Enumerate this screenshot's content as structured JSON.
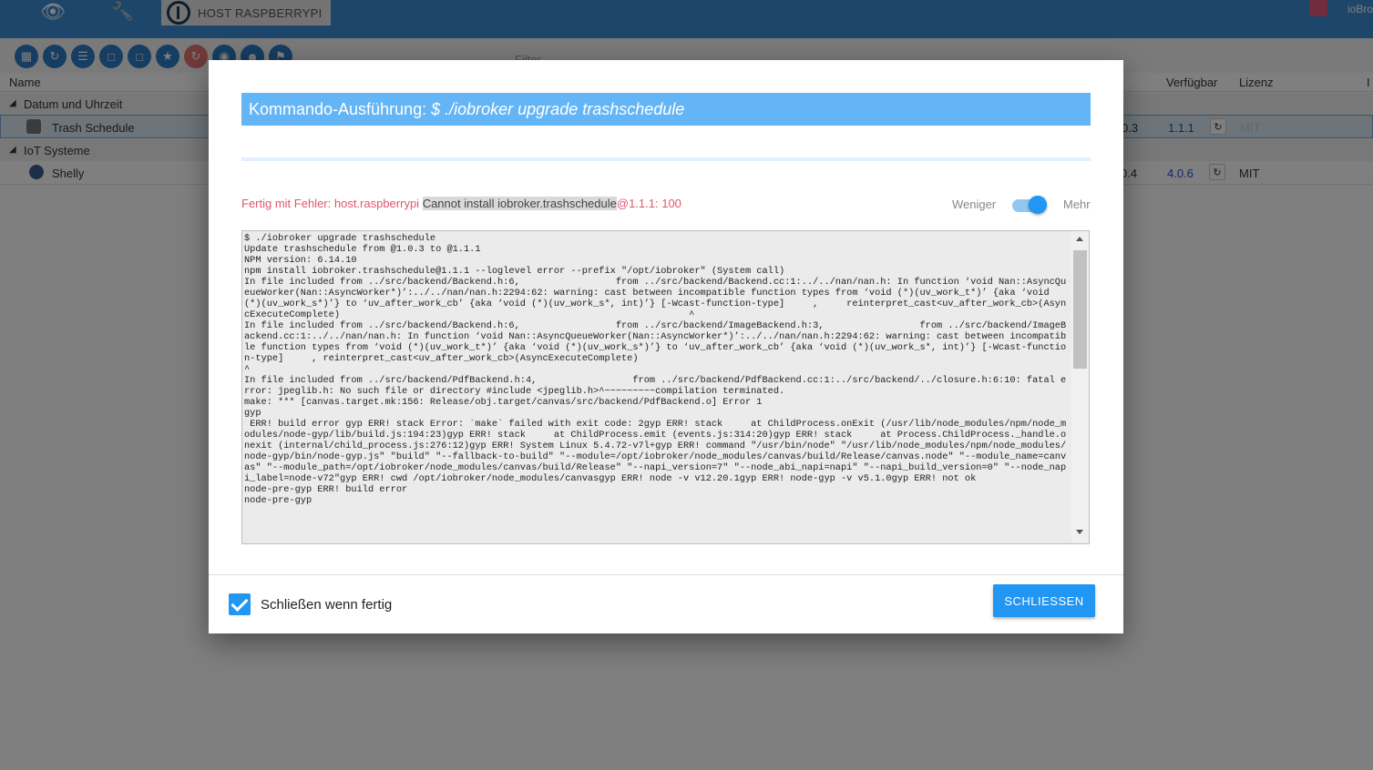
{
  "topbar": {
    "host_tab_label": "HOST RASPBERRYPI",
    "user_label": "ioBro"
  },
  "toolbar": {
    "filter_label": "Filter"
  },
  "table": {
    "headers": {
      "name": "Name",
      "available": "Verfügbar",
      "license": "Lizenz",
      "extra": "I"
    },
    "groups": [
      {
        "label": "Datum und Uhrzeit",
        "items": [
          {
            "name": "Trash Schedule",
            "installed": "0.3",
            "available": "1.1.1",
            "license": "MIT"
          }
        ]
      },
      {
        "label": "IoT Systeme",
        "items": [
          {
            "name": "Shelly",
            "installed": "0.4",
            "available": "4.0.6",
            "license": "MIT"
          }
        ]
      }
    ]
  },
  "dialog": {
    "title_prefix": "Kommando-Ausführung: ",
    "title_command": "$ ./iobroker upgrade trashschedule",
    "status_prefix": "Fertig mit Fehler: host.raspberrypi ",
    "status_highlight": "Cannot install iobroker.trashschedule",
    "status_suffix": "@1.1.1: 100",
    "toggle_less": "Weniger",
    "toggle_more": "Mehr",
    "toggle_state": "on",
    "log_lines": [
      "$ ./iobroker upgrade trashschedule",
      "Update trashschedule from @1.0.3 to @1.1.1",
      "NPM version: 6.14.10",
      "npm install iobroker.trashschedule@1.1.1 --loglevel error --prefix \"/opt/iobroker\" (System call)",
      "In file included from ../src/backend/Backend.h:6,                 from ../src/backend/Backend.cc:1:../../nan/nan.h: In function ‘void Nan::AsyncQueueWorker(Nan::AsyncWorker*)’:../../nan/nan.h:2294:62: warning: cast between incompatible function types from ‘void (*)(uv_work_t*)’ {aka ‘void (*)(uv_work_s*)’} to ‘uv_after_work_cb’ {aka ‘void (*)(uv_work_s*, int)’} [-Wcast-function-type]     ,     reinterpret_cast<uv_after_work_cb>(AsyncExecuteComplete)                                                              ^",
      "In file included from ../src/backend/Backend.h:6,                 from ../src/backend/ImageBackend.h:3,                 from ../src/backend/ImageBackend.cc:1:../../nan/nan.h: In function ‘void Nan::AsyncQueueWorker(Nan::AsyncWorker*)’:../../nan/nan.h:2294:62: warning: cast between incompatible function types from ‘void (*)(uv_work_t*)’ {aka ‘void (*)(uv_work_s*)’} to ‘uv_after_work_cb’ {aka ‘void (*)(uv_work_s*, int)’} [-Wcast-function-type]     , reinterpret_cast<uv_after_work_cb>(AsyncExecuteComplete)",
      "^",
      "In file included from ../src/backend/PdfBackend.h:4,                 from ../src/backend/PdfBackend.cc:1:../src/backend/../closure.h:6:10: fatal error: jpeglib.h: No such file or directory #include <jpeglib.h>^~~~~~~~~~compilation terminated.",
      "make: *** [canvas.target.mk:156: Release/obj.target/canvas/src/backend/PdfBackend.o] Error 1",
      "gyp",
      " ERR! build error gyp ERR! stack Error: `make` failed with exit code: 2gyp ERR! stack     at ChildProcess.onExit (/usr/lib/node_modules/npm/node_modules/node-gyp/lib/build.js:194:23)gyp ERR! stack     at ChildProcess.emit (events.js:314:20)gyp ERR! stack     at Process.ChildProcess._handle.onexit (internal/child_process.js:276:12)gyp ERR! System Linux 5.4.72-v7l+gyp ERR! command \"/usr/bin/node\" \"/usr/lib/node_modules/npm/node_modules/node-gyp/bin/node-gyp.js\" \"build\" \"--fallback-to-build\" \"--module=/opt/iobroker/node_modules/canvas/build/Release/canvas.node\" \"--module_name=canvas\" \"--module_path=/opt/iobroker/node_modules/canvas/build/Release\" \"--napi_version=7\" \"--node_abi_napi=napi\" \"--napi_build_version=0\" \"--node_napi_label=node-v72\"gyp ERR! cwd /opt/iobroker/node_modules/canvasgyp ERR! node -v v12.20.1gyp ERR! node-gyp -v v5.1.0gyp ERR! not ok",
      "node-pre-gyp ERR! build error",
      "node-pre-gyp"
    ],
    "close_when_done_label": "Schließen wenn fertig",
    "close_when_done_checked": true,
    "close_button_label": "SCHLIESSEN"
  },
  "colors": {
    "accent": "#2196f3",
    "title_bar": "#64b5f6",
    "error_text": "#e0566f",
    "topbar": "#3b8cd4"
  }
}
